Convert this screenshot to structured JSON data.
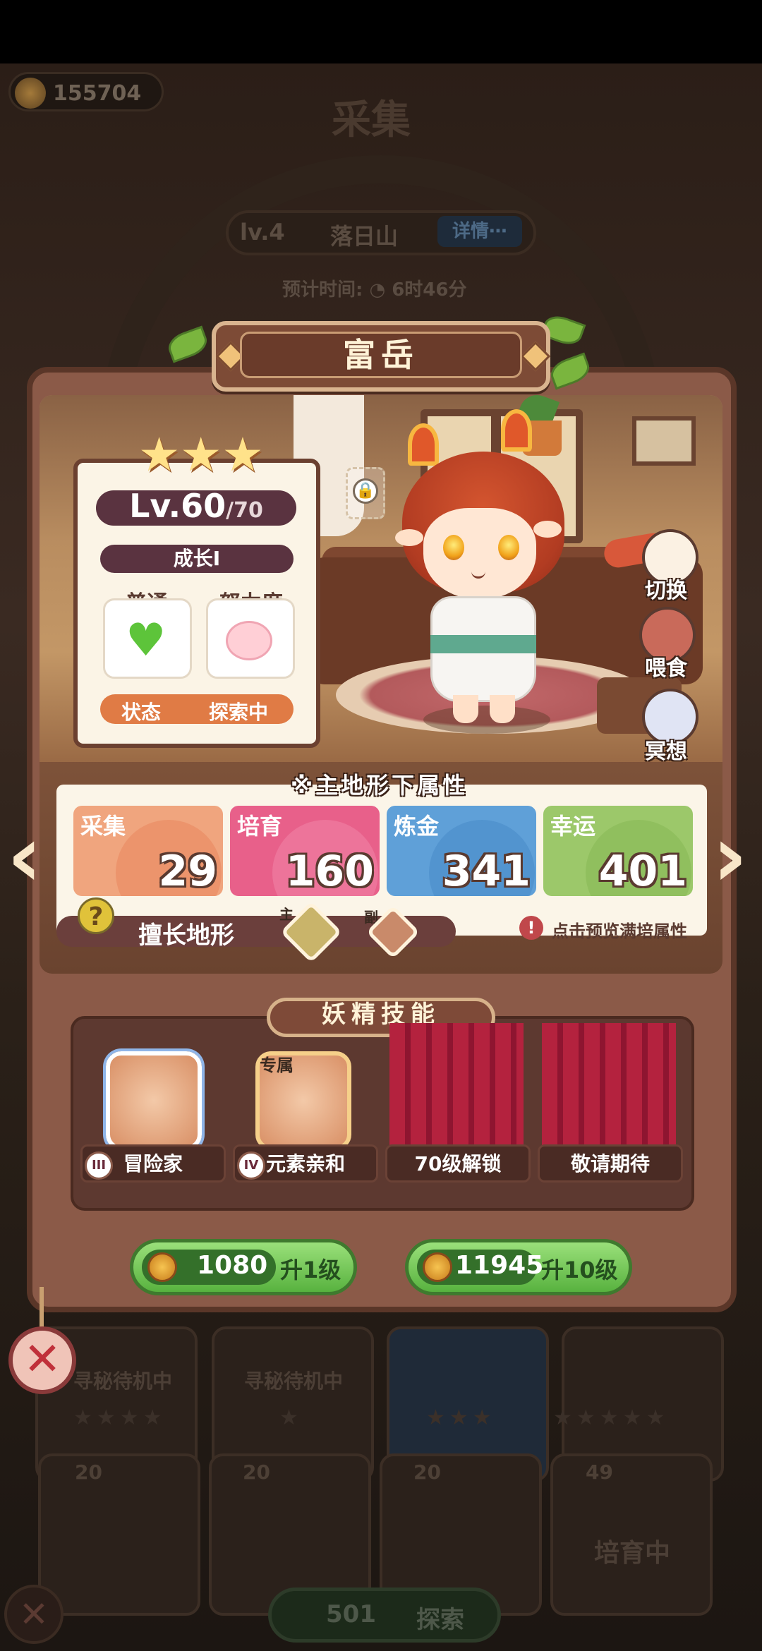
{
  "background": {
    "coins": "155704",
    "title": "采集",
    "location_level": "lv.4",
    "location_name": "落日山",
    "detail_button": "详情⋯",
    "estimate_time": "预计时间: ◔ 6时46分",
    "card_labels": [
      "寻秘待机中",
      "寻秘待机中"
    ],
    "card_levels": [
      "20",
      "20",
      "20",
      "49"
    ],
    "training_label": "培育中",
    "explore_cost": "501",
    "explore_label": "探索"
  },
  "fairy": {
    "name": "富岳",
    "stars": "★★★",
    "level": "Lv.60",
    "level_max": "/70",
    "growth": "成长I",
    "mood_label": "普通",
    "effort_label": "努力度",
    "status_label": "状态",
    "status_value": "探索中"
  },
  "side_actions": {
    "switch": "切换",
    "feed": "喂食",
    "meditate": "冥想"
  },
  "attributes": {
    "title": "※主地形下属性",
    "items": [
      {
        "label": "采集",
        "value": "29",
        "color": "#f0a57e"
      },
      {
        "label": "培育",
        "value": "160",
        "color": "#e8608a"
      },
      {
        "label": "炼金",
        "value": "341",
        "color": "#5fa0d8"
      },
      {
        "label": "幸运",
        "value": "401",
        "color": "#9cc86a"
      }
    ],
    "terrain_label": "擅长地形",
    "terrain_main": "主",
    "terrain_sub": "副",
    "preview_text": "点击预览满培属性"
  },
  "skills": {
    "title": "妖精技能",
    "exclusive_tag": "专属",
    "slots": [
      {
        "name": "冒险家",
        "roman": "III"
      },
      {
        "name": "元素亲和",
        "roman": "IV"
      },
      {
        "name": "70级解锁"
      },
      {
        "name": "敬请期待"
      }
    ]
  },
  "upgrade": {
    "one": {
      "cost": "1080",
      "label": "升1级"
    },
    "ten": {
      "cost": "11945",
      "label": "升10级"
    }
  },
  "colors": {
    "panel": "#8b5a48",
    "accent_green": "#58b23f",
    "close_red": "#c0303a"
  }
}
